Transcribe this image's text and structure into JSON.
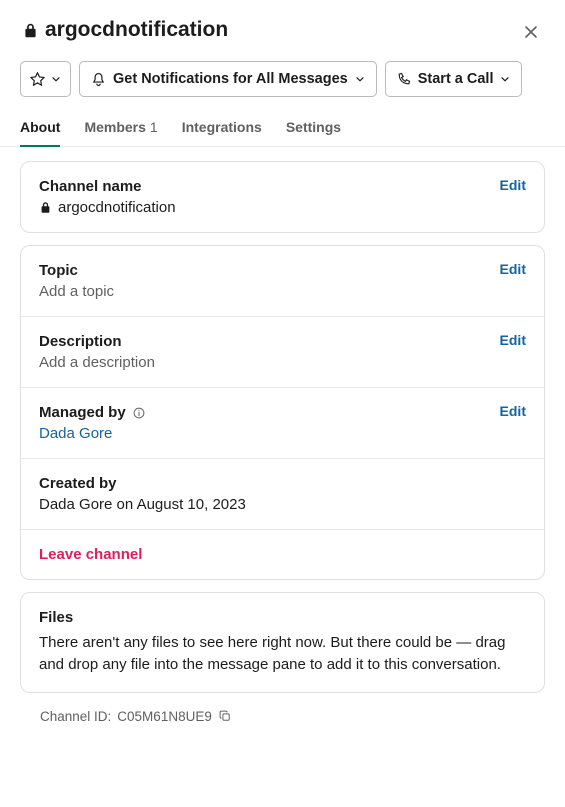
{
  "header": {
    "title": "argocdnotification"
  },
  "actions": {
    "notifications": "Get Notifications for All Messages",
    "call": "Start a Call"
  },
  "tabs": {
    "about": "About",
    "members_label": "Members",
    "members_count": "1",
    "integrations": "Integrations",
    "settings": "Settings"
  },
  "channel_name": {
    "label": "Channel name",
    "value": "argocdnotification",
    "edit": "Edit"
  },
  "topic": {
    "label": "Topic",
    "placeholder": "Add a topic",
    "edit": "Edit"
  },
  "description": {
    "label": "Description",
    "placeholder": "Add a description",
    "edit": "Edit"
  },
  "managed_by": {
    "label": "Managed by",
    "value": "Dada Gore",
    "edit": "Edit"
  },
  "created_by": {
    "label": "Created by",
    "value": "Dada Gore on August 10, 2023"
  },
  "leave": "Leave channel",
  "files": {
    "label": "Files",
    "body": "There aren't any files to see here right now. But there could be — drag and drop any file into the message pane to add it to this conversation."
  },
  "channel_id": {
    "prefix": "Channel ID:",
    "value": "C05M61N8UE9"
  }
}
